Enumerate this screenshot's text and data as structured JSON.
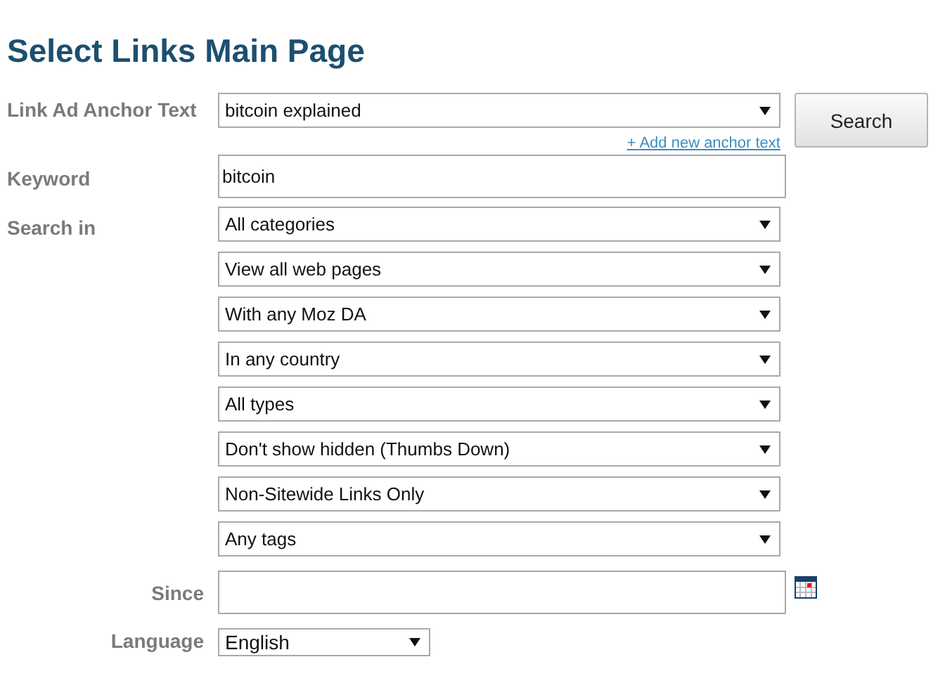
{
  "title": "Select Links Main Page",
  "anchor_text": {
    "label": "Link Ad Anchor Text",
    "value": "bitcoin explained",
    "link": "+ Add new anchor text"
  },
  "search_button": "Search",
  "keyword": {
    "label": "Keyword",
    "value": "bitcoin"
  },
  "search_in": {
    "label": "Search in",
    "selects": [
      "All categories",
      "View all web pages",
      "With any Moz DA",
      "In any country",
      "All types",
      "Don't show hidden (Thumbs Down)",
      "Non-Sitewide Links Only",
      "Any tags"
    ]
  },
  "since": {
    "label": "Since"
  },
  "language": {
    "label": "Language",
    "value": "English"
  }
}
